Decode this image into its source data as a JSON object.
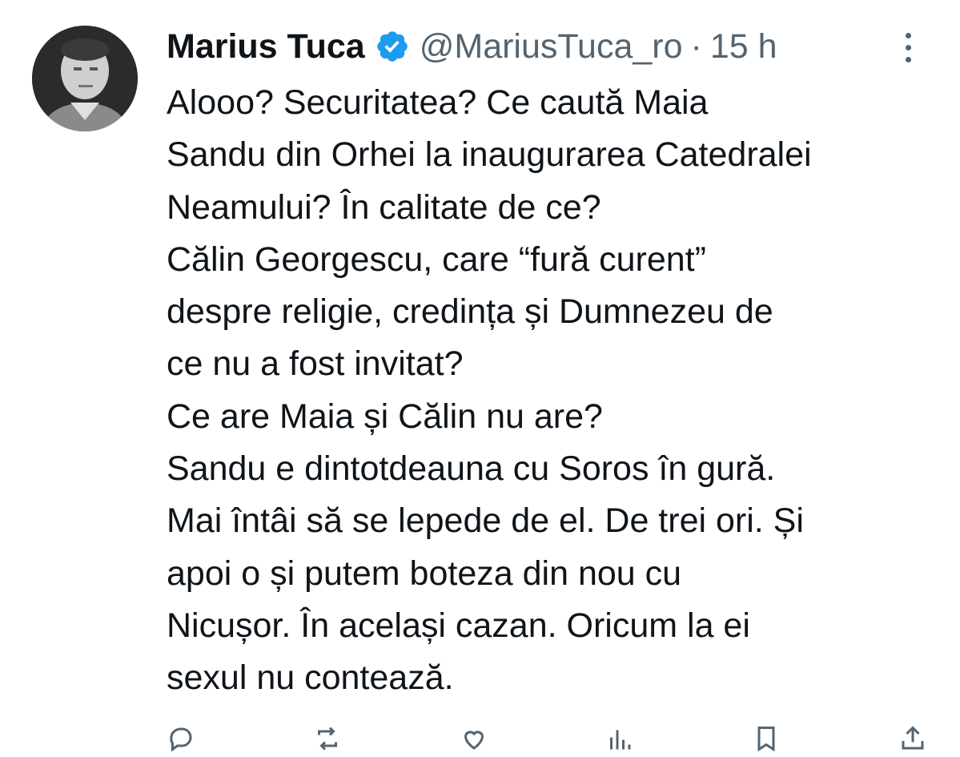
{
  "tweet": {
    "author": {
      "display_name": "Marius Tuca",
      "handle": "@MariusTuca_ro",
      "verified": true
    },
    "separator": "·",
    "time": "15 h",
    "text_lines": [
      "Alooo? Securitatea? Ce caută Maia",
      "Sandu din Orhei la inaugurarea Catedralei",
      "Neamului? În calitate de ce?",
      "Călin Georgescu, care “fură curent”",
      "despre religie, credința și Dumnezeu de",
      "ce nu a fost invitat?",
      "Ce are Maia și Călin nu are?",
      "Sandu e dintotdeauna cu Soros în gură.",
      "Mai întâi să se lepede de el. De trei ori. Și",
      "apoi o și putem boteza din nou cu",
      "Nicușor. În același cazan. Oricum la ei",
      "sexul nu contează."
    ]
  },
  "icons": {
    "verified": "verified-badge-icon",
    "more": "more-options-icon",
    "reply": "reply-icon",
    "retweet": "retweet-icon",
    "like": "heart-icon",
    "views": "views-icon",
    "bookmark": "bookmark-icon",
    "share": "share-icon"
  },
  "colors": {
    "text": "#0f1419",
    "secondary": "#536471",
    "verified_blue": "#1d9bf0"
  }
}
